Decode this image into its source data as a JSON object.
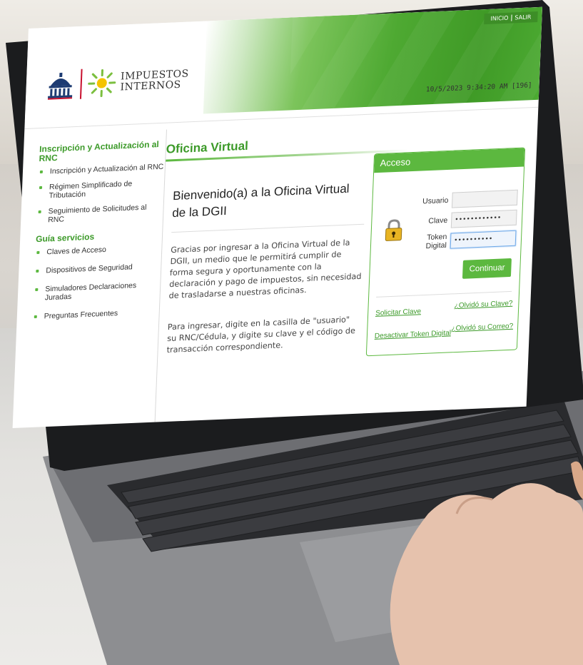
{
  "header": {
    "logo_line1": "IMPUESTOS",
    "logo_line2": "INTERNOS",
    "top_link_inicio": "INICIO",
    "top_link_salir": "SALIR",
    "datetime": "10/5/2023 9:34:20 AM",
    "session_code": "[196]"
  },
  "sidebar": {
    "section1_title": "Inscripción y Actualización al RNC",
    "section1_items": [
      "Inscripción y Actualización al RNC",
      "Régimen Simplificado de Tributación",
      "Seguimiento de Solicitudes al RNC"
    ],
    "section2_title": "Guía servicios",
    "section2_items": [
      "Claves de Acceso",
      "Dispositivos de Seguridad",
      "Simuladores Declaraciones Juradas",
      "Preguntas Frecuentes"
    ]
  },
  "main": {
    "title": "Oficina Virtual",
    "welcome": "Bienvenido(a) a la Oficina Virtual de la DGII",
    "paragraph1": "Gracias por ingresar a la Oficina Virtual de la DGII, un medio que le permitirá cumplir de forma segura y oportunamente con la declaración y pago de impuestos, sin necesidad de trasladarse a nuestras oficinas.",
    "paragraph2": "Para ingresar, digite en la casilla de \"usuario\" su RNC/Cédula, y digite su clave y el código de transacción correspondiente."
  },
  "acceso": {
    "title": "Acceso",
    "usuario_label": "Usuario",
    "usuario_value": "",
    "clave_label": "Clave",
    "clave_value": "••••••••••••",
    "token_label": "Token Digital",
    "token_value": "••••••••••",
    "continue_label": "Continuar",
    "link_solicitar": "Solicitar Clave",
    "link_olvido_clave": "¿Olvidó su Clave?",
    "link_desactivar": "Desactivar Token Digital",
    "link_olvido_correo": "¿Olvidó su Correo?"
  },
  "colors": {
    "brand_green": "#5cb83f",
    "heading_green": "#3c9a29",
    "header_green_dark": "#3f9a26"
  }
}
